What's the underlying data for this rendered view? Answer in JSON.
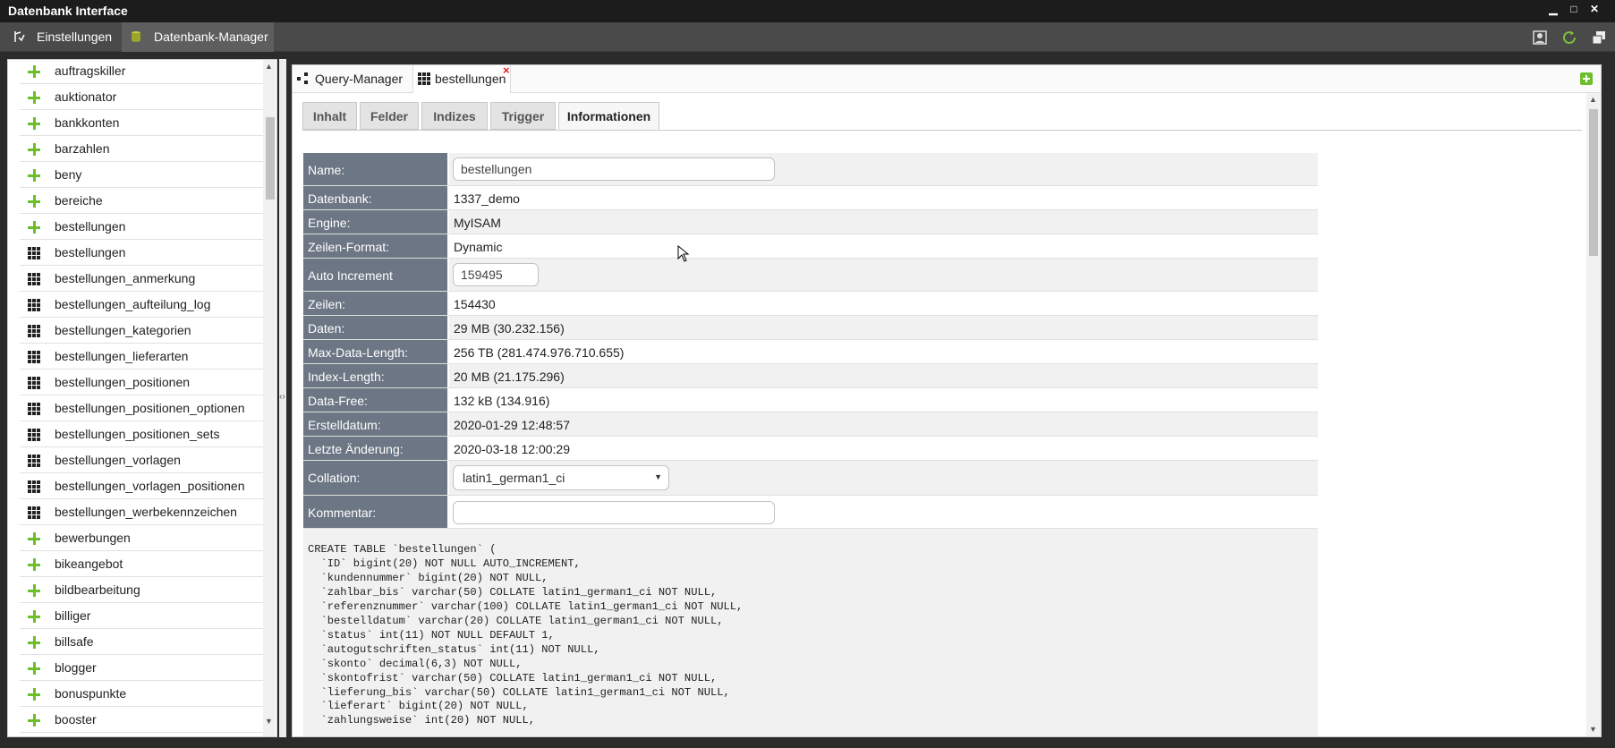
{
  "window": {
    "title": "Datenbank Interface",
    "controls": {
      "minimize": "▁",
      "maximize": "□",
      "close": "✕"
    }
  },
  "menubar": {
    "items": [
      {
        "label": "Einstellungen",
        "icon": "settings-icon"
      },
      {
        "label": "Datenbank-Manager",
        "icon": "database-icon"
      }
    ],
    "right_icons": [
      "user-icon",
      "refresh-icon",
      "windows-icon"
    ]
  },
  "sidebar": {
    "items": [
      {
        "label": "auftragskiller",
        "icon": "plus-icon"
      },
      {
        "label": "auktionator",
        "icon": "plus-icon"
      },
      {
        "label": "bankkonten",
        "icon": "plus-icon"
      },
      {
        "label": "barzahlen",
        "icon": "plus-icon"
      },
      {
        "label": "beny",
        "icon": "plus-icon"
      },
      {
        "label": "bereiche",
        "icon": "plus-icon"
      },
      {
        "label": "bestellungen",
        "icon": "plus-icon"
      },
      {
        "label": "bestellungen",
        "icon": "table-icon"
      },
      {
        "label": "bestellungen_anmerkung",
        "icon": "table-icon"
      },
      {
        "label": "bestellungen_aufteilung_log",
        "icon": "table-icon"
      },
      {
        "label": "bestellungen_kategorien",
        "icon": "table-icon"
      },
      {
        "label": "bestellungen_lieferarten",
        "icon": "table-icon"
      },
      {
        "label": "bestellungen_positionen",
        "icon": "table-icon"
      },
      {
        "label": "bestellungen_positionen_optionen",
        "icon": "table-icon"
      },
      {
        "label": "bestellungen_positionen_sets",
        "icon": "table-icon"
      },
      {
        "label": "bestellungen_vorlagen",
        "icon": "table-icon"
      },
      {
        "label": "bestellungen_vorlagen_positionen",
        "icon": "table-icon"
      },
      {
        "label": "bestellungen_werbekennzeichen",
        "icon": "table-icon"
      },
      {
        "label": "bewerbungen",
        "icon": "plus-icon"
      },
      {
        "label": "bikeangebot",
        "icon": "plus-icon"
      },
      {
        "label": "bildbearbeitung",
        "icon": "plus-icon"
      },
      {
        "label": "billiger",
        "icon": "plus-icon"
      },
      {
        "label": "billsafe",
        "icon": "plus-icon"
      },
      {
        "label": "blogger",
        "icon": "plus-icon"
      },
      {
        "label": "bonuspunkte",
        "icon": "plus-icon"
      },
      {
        "label": "booster",
        "icon": "plus-icon"
      }
    ],
    "splitter_grip": "‹›"
  },
  "doc_tabs": [
    {
      "label": "Query-Manager",
      "icon": "query-icon"
    },
    {
      "label": "bestellungen",
      "icon": "table-icon",
      "close": "×"
    }
  ],
  "sub_tabs": [
    "Inhalt",
    "Felder",
    "Indizes",
    "Trigger",
    "Informationen"
  ],
  "info": {
    "name": {
      "label": "Name:",
      "value": "bestellungen"
    },
    "datenbank": {
      "label": "Datenbank:",
      "value": "1337_demo"
    },
    "engine": {
      "label": "Engine:",
      "value": "MyISAM"
    },
    "zeilen_format": {
      "label": "Zeilen-Format:",
      "value": "Dynamic"
    },
    "auto_increment": {
      "label": "Auto Increment",
      "value": "159495"
    },
    "zeilen": {
      "label": "Zeilen:",
      "value": "154430"
    },
    "daten": {
      "label": "Daten:",
      "value": "29 MB (30.232.156)"
    },
    "max_data_length": {
      "label": "Max-Data-Length:",
      "value": "256 TB (281.474.976.710.655)"
    },
    "index_length": {
      "label": "Index-Length:",
      "value": "20 MB (21.175.296)"
    },
    "data_free": {
      "label": "Data-Free:",
      "value": "132 kB (134.916)"
    },
    "erstelldatum": {
      "label": "Erstelldatum:",
      "value": "2020-01-29 12:48:57"
    },
    "letzte_aenderung": {
      "label": "Letzte Änderung:",
      "value": "2020-03-18 12:00:29"
    },
    "collation": {
      "label": "Collation:",
      "value": "latin1_german1_ci",
      "caret": "▼"
    },
    "kommentar": {
      "label": "Kommentar:",
      "value": ""
    }
  },
  "sql": "CREATE TABLE `bestellungen` (\n  `ID` bigint(20) NOT NULL AUTO_INCREMENT,\n  `kundennummer` bigint(20) NOT NULL,\n  `zahlbar_bis` varchar(50) COLLATE latin1_german1_ci NOT NULL,\n  `referenznummer` varchar(100) COLLATE latin1_german1_ci NOT NULL,\n  `bestelldatum` varchar(20) COLLATE latin1_german1_ci NOT NULL,\n  `status` int(11) NOT NULL DEFAULT 1,\n  `autogutschriften_status` int(11) NOT NULL,\n  `skonto` decimal(6,3) NOT NULL,\n  `skontofrist` varchar(50) COLLATE latin1_german1_ci NOT NULL,\n  `lieferung_bis` varchar(50) COLLATE latin1_german1_ci NOT NULL,\n  `lieferart` bigint(20) NOT NULL,\n  `zahlungsweise` int(20) NOT NULL,",
  "scroll": {
    "up": "▲",
    "down": "▼"
  },
  "colors": {
    "accent_green": "#6cbf2a",
    "key_bg": "#6c7684",
    "close_red": "#e02020"
  }
}
